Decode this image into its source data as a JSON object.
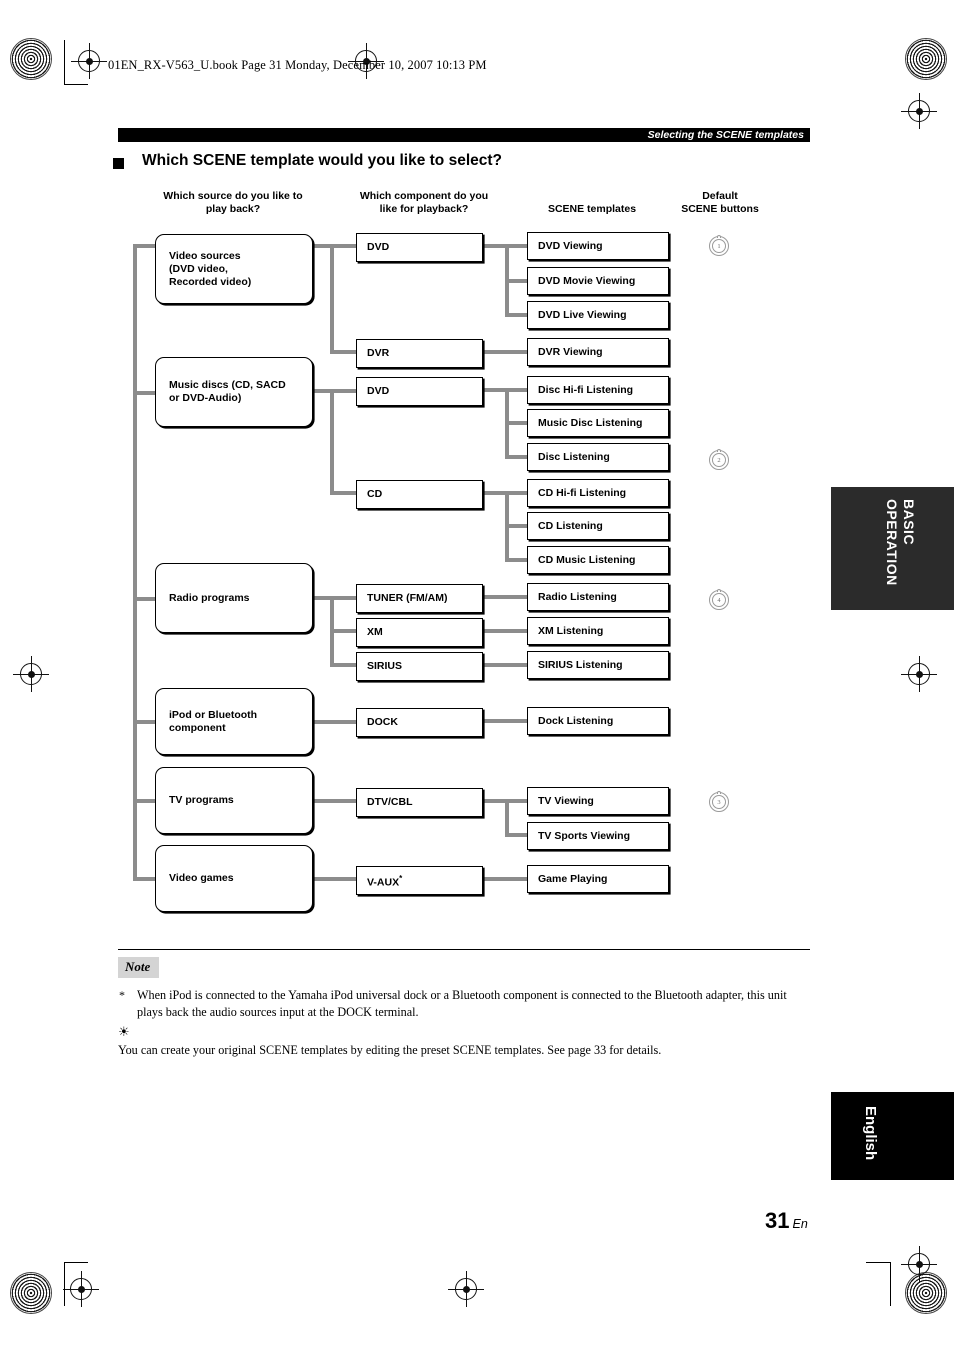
{
  "header": {
    "file_line": "01EN_RX-V563_U.book  Page 31  Monday, December 10, 2007  10:13 PM",
    "running_head": "Selecting the SCENE templates"
  },
  "section": {
    "title": "Which SCENE template would you like to select?"
  },
  "columns": {
    "source": "Which source do you like to\nplay back?",
    "component": "Which component do you\nlike for playback?",
    "templates": "SCENE templates",
    "buttons": "Default\nSCENE buttons"
  },
  "sources": [
    {
      "label": "Video sources\n(DVD video,\nRecorded video)"
    },
    {
      "label": "Music discs (CD, SACD\nor DVD-Audio)"
    },
    {
      "label": "Radio programs"
    },
    {
      "label": "iPod or Bluetooth\ncomponent"
    },
    {
      "label": "TV programs"
    },
    {
      "label": "Video games"
    }
  ],
  "components": [
    {
      "label": "DVD"
    },
    {
      "label": "DVR"
    },
    {
      "label": "DVD"
    },
    {
      "label": "CD"
    },
    {
      "label": "TUNER (FM/AM)"
    },
    {
      "label": "XM"
    },
    {
      "label": "SIRIUS"
    },
    {
      "label": "DOCK"
    },
    {
      "label": "DTV/CBL"
    },
    {
      "label": "V-AUX",
      "footnote": "*"
    }
  ],
  "templates": [
    {
      "label": "DVD Viewing"
    },
    {
      "label": "DVD Movie Viewing"
    },
    {
      "label": "DVD Live Viewing"
    },
    {
      "label": "DVR Viewing"
    },
    {
      "label": "Disc Hi-fi Listening"
    },
    {
      "label": "Music Disc Listening"
    },
    {
      "label": "Disc Listening"
    },
    {
      "label": "CD Hi-fi Listening"
    },
    {
      "label": "CD Listening"
    },
    {
      "label": "CD Music Listening"
    },
    {
      "label": "Radio Listening"
    },
    {
      "label": "XM Listening"
    },
    {
      "label": "SIRIUS Listening"
    },
    {
      "label": "Dock Listening"
    },
    {
      "label": "TV Viewing"
    },
    {
      "label": "TV Sports Viewing"
    },
    {
      "label": "Game Playing"
    }
  ],
  "scene_buttons": [
    {
      "number": "1"
    },
    {
      "number": "2"
    },
    {
      "number": "4"
    },
    {
      "number": "3"
    }
  ],
  "note": {
    "badge": "Note",
    "star": "*",
    "text": "When iPod is connected to the Yamaha iPod universal dock or a Bluetooth component is connected to the Bluetooth adapter, this unit plays back the audio sources input at the DOCK terminal.",
    "tip_icon": "☀",
    "tip_text": "You can create your original SCENE templates by editing the preset SCENE templates. See page 33 for details."
  },
  "side_tabs": {
    "chapter": "BASIC\nOPERATION",
    "language": "English"
  },
  "footer": {
    "page_number": "31",
    "page_suffix": "En"
  },
  "colors": {
    "connector": "#8c8c8c",
    "bar": "#000000",
    "tab_chapter": "#2b2b2b",
    "tab_language": "#000000",
    "note_badge": "#d4d4d4"
  }
}
